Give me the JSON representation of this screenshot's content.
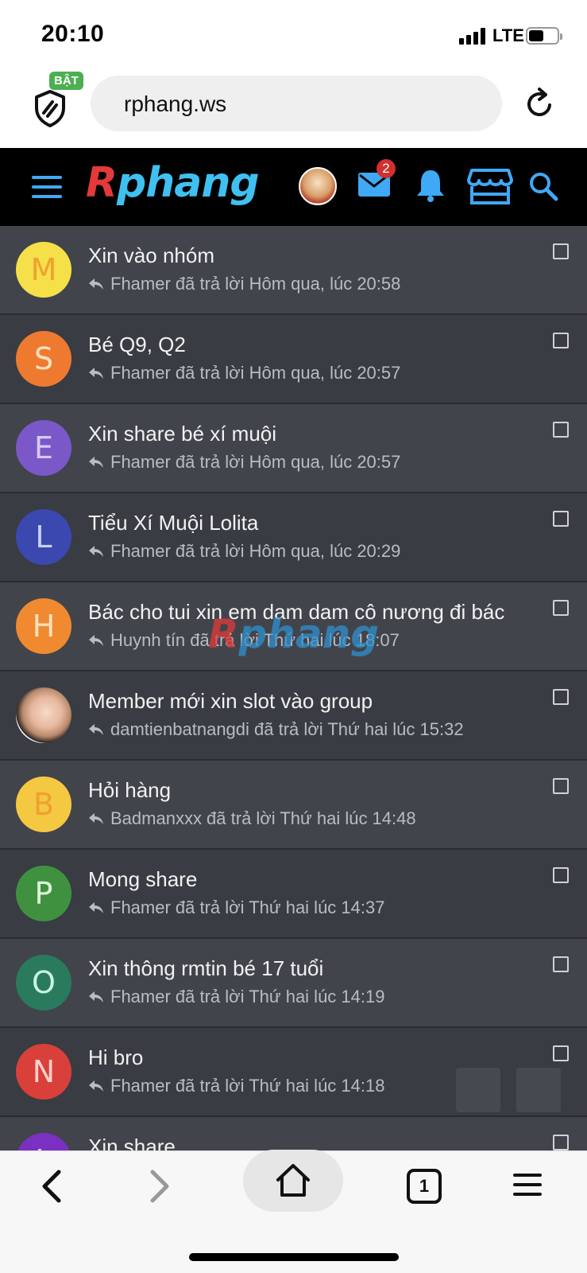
{
  "status_bar": {
    "time": "20:10",
    "network": "LTE"
  },
  "browser": {
    "shield_badge": "BẬT",
    "url": "rphang.ws"
  },
  "forum": {
    "logo_first": "R",
    "logo_rest": "phang",
    "mail_badge": "2",
    "icons": [
      "menu-icon",
      "mail-icon",
      "bell-icon",
      "store-icon",
      "search-icon"
    ]
  },
  "threads": [
    {
      "initial": "M",
      "color": "#f5e04a",
      "text_color": "#f0a030",
      "title": "Xin vào nhóm",
      "meta": "Fhamer đã trả lời Hôm qua, lúc 20:58"
    },
    {
      "initial": "S",
      "color": "#ee7a30",
      "text_color": "#ffe0c0",
      "title": "Bé Q9, Q2",
      "meta": "Fhamer đã trả lời Hôm qua, lúc 20:57"
    },
    {
      "initial": "E",
      "color": "#7a58c8",
      "text_color": "#d8c8f8",
      "title": "Xin share bé xí muội",
      "meta": "Fhamer đã trả lời Hôm qua, lúc 20:57"
    },
    {
      "initial": "L",
      "color": "#3a48b0",
      "text_color": "#c8d0f8",
      "title": "Tiểu Xí Muội Lolita",
      "meta": "Fhamer đã trả lời Hôm qua, lúc 20:29"
    },
    {
      "initial": "H",
      "color": "#f08a30",
      "text_color": "#ffe2c0",
      "title": "Bác cho tui xin em dam dam cô nương đi bác",
      "meta": "Huynh tín đã trả lời Thứ hai lúc 18:07"
    },
    {
      "initial": "",
      "color": "#cccccc",
      "text_color": "#ffffff",
      "photo": true,
      "title": "Member mới xin slot vào group",
      "meta": "damtienbatnangdi đã trả lời Thứ hai lúc 15:32"
    },
    {
      "initial": "B",
      "color": "#f5c842",
      "text_color": "#f0a030",
      "title": "Hỏi hàng",
      "meta": "Badmanxxx đã trả lời Thứ hai lúc 14:48"
    },
    {
      "initial": "P",
      "color": "#3f9140",
      "text_color": "#e0f5d8",
      "title": "Mong share",
      "meta": "Fhamer đã trả lời Thứ hai lúc 14:37"
    },
    {
      "initial": "O",
      "color": "#2a7a5e",
      "text_color": "#c8f5e4",
      "title": "Xin thông rmtin bé 17 tuổi",
      "meta": "Fhamer đã trả lời Thứ hai lúc 14:19"
    },
    {
      "initial": "N",
      "color": "#d9403a",
      "text_color": "#ffd0c8",
      "title": "Hi bro",
      "meta": "Fhamer đã trả lời Thứ hai lúc 14:18"
    },
    {
      "initial": "L",
      "color": "#7a30c0",
      "text_color": "#e8d0ff",
      "title": "Xin share",
      "meta": ""
    }
  ],
  "toolbar": {
    "tab_count": "1"
  }
}
